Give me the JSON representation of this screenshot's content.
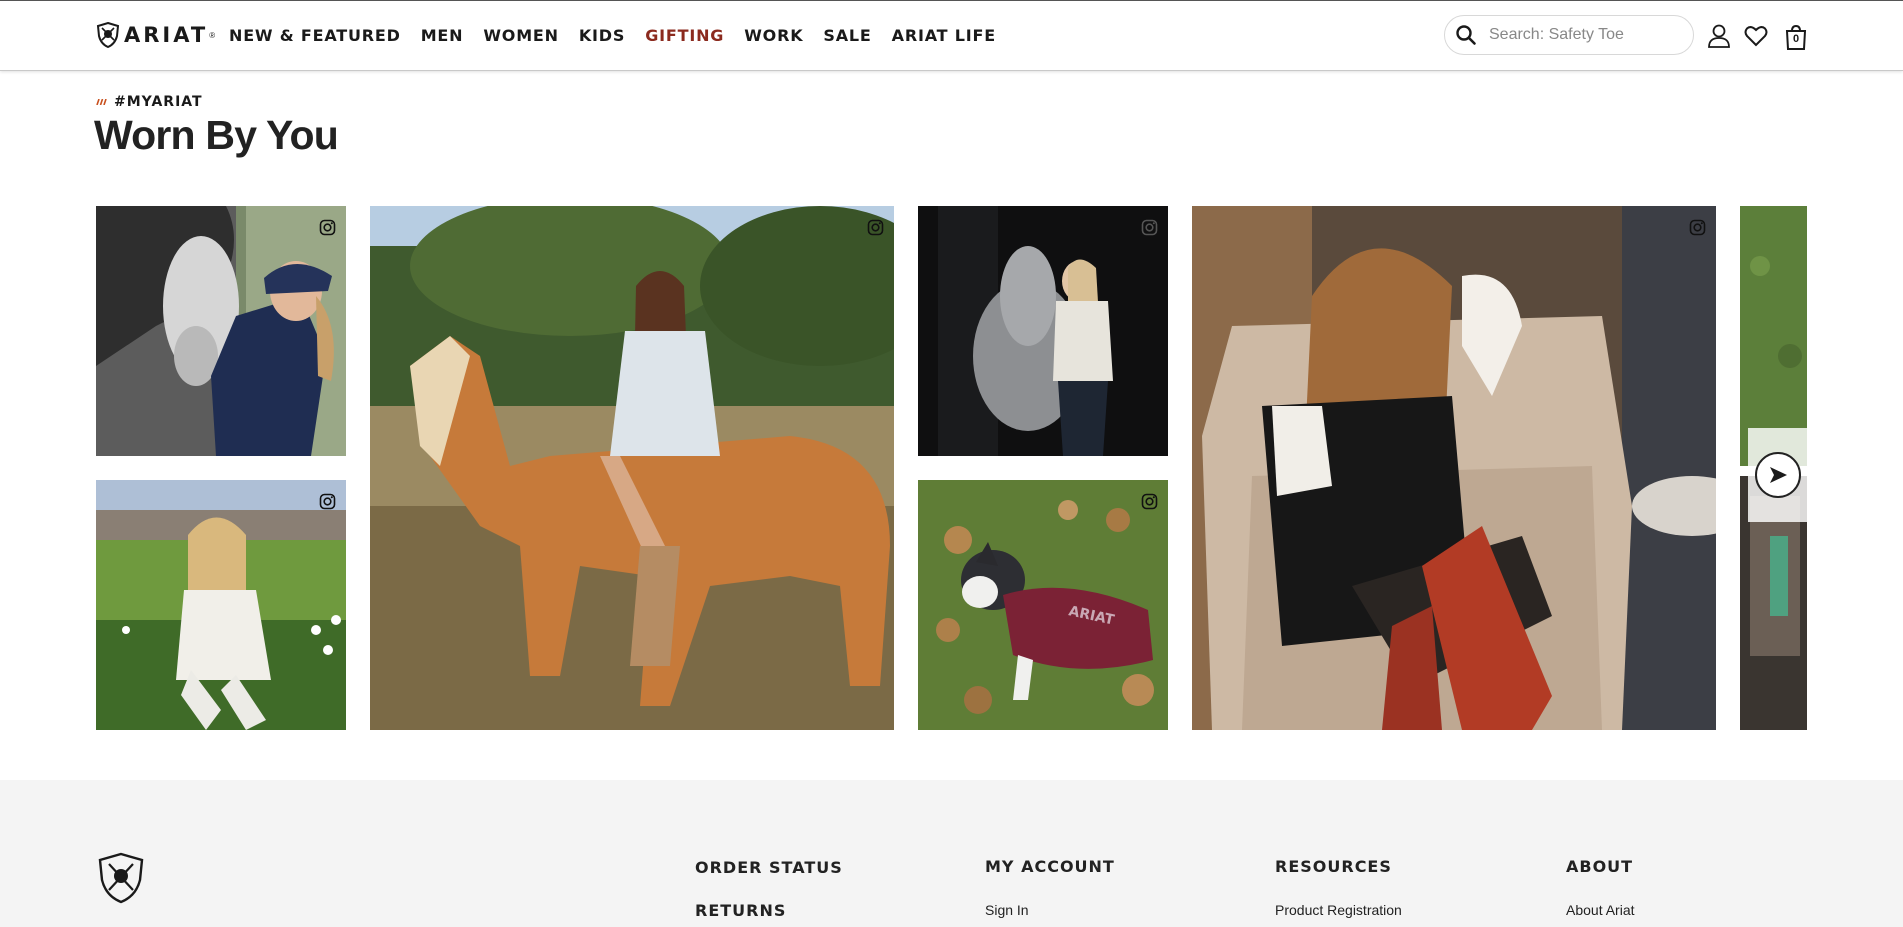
{
  "brand": {
    "name": "ARIAT",
    "tm": "®"
  },
  "nav": [
    {
      "label": "NEW & FEATURED",
      "color": "#1a1a1a"
    },
    {
      "label": "MEN",
      "color": "#1a1a1a"
    },
    {
      "label": "WOMEN",
      "color": "#1a1a1a"
    },
    {
      "label": "KIDS",
      "color": "#1a1a1a"
    },
    {
      "label": "GIFTING",
      "color": "#8b2a1e"
    },
    {
      "label": "WORK",
      "color": "#1a1a1a"
    },
    {
      "label": "SALE",
      "color": "#1a1a1a"
    },
    {
      "label": "ARIAT LIFE",
      "color": "#1a1a1a"
    }
  ],
  "search": {
    "placeholder": "Search: Safety Toe"
  },
  "header_icons": {
    "account": "user-icon",
    "wishlist": "heart-icon",
    "cart": "bag-icon",
    "cart_count": "0"
  },
  "section": {
    "eyebrow": "#MYARIAT",
    "title": "Worn By You",
    "accent": "#c8501e"
  },
  "gallery": {
    "tiles": [
      {
        "name": "ugc-photo-horse-cap",
        "icon": "instagram-icon"
      },
      {
        "name": "ugc-photo-flower-field",
        "icon": "instagram-icon"
      },
      {
        "name": "ugc-photo-palomino-rider",
        "icon": "instagram-icon"
      },
      {
        "name": "ugc-photo-grey-horse-night",
        "icon": "instagram-icon"
      },
      {
        "name": "ugc-photo-dog-vest",
        "icon": "instagram-icon"
      },
      {
        "name": "ugc-photo-red-boots-chair",
        "icon": "instagram-icon"
      },
      {
        "name": "ugc-photo-partial",
        "icon": "instagram-icon"
      }
    ],
    "next_icon": "arrow-right-icon",
    "dog_vest_text": "ARIAT"
  },
  "footer": {
    "columns": [
      {
        "heading": "ORDER STATUS",
        "links": []
      },
      {
        "heading": "RETURNS",
        "links": []
      },
      {
        "heading": "MY ACCOUNT",
        "links": [
          "Sign In"
        ]
      },
      {
        "heading": "RESOURCES",
        "links": [
          "Product Registration"
        ]
      },
      {
        "heading": "ABOUT",
        "links": [
          "About Ariat"
        ]
      }
    ]
  }
}
